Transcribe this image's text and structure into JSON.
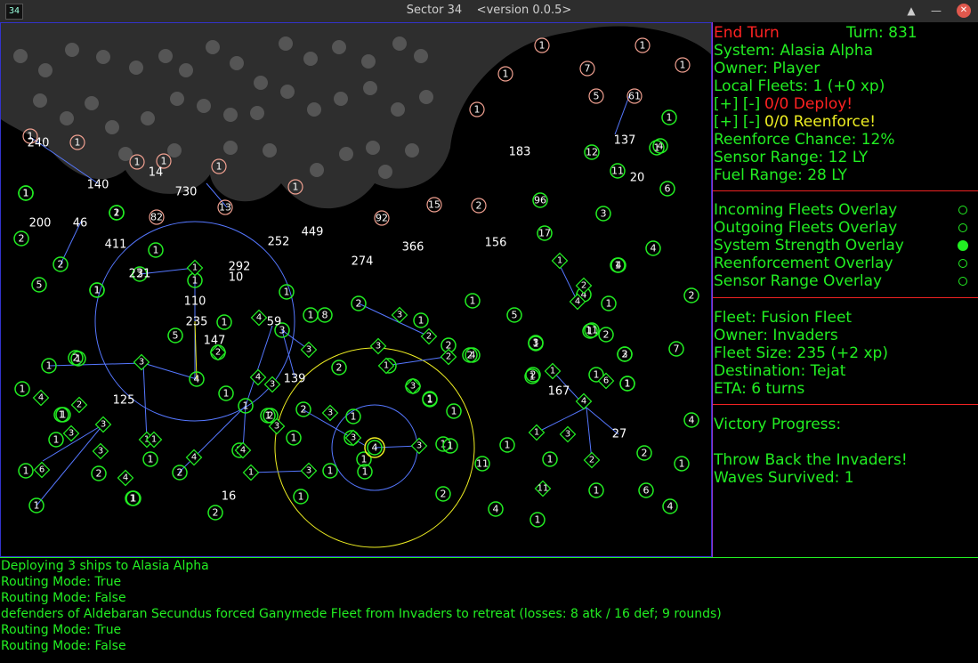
{
  "window": {
    "app_icon_text": "34",
    "title": "Sector 34    <version 0.0.5>",
    "buttons": [
      "up-icon",
      "minimize-icon",
      "close-icon"
    ]
  },
  "colors": {
    "background": "#000000",
    "friendly": "#22ee22",
    "enemy": "#f0a090",
    "neutral": "#ffffff",
    "highlight": "#ff2222",
    "warning": "#eeee22",
    "range_ring": "#5577ff",
    "selection_ring": "#eeee22",
    "nebula": "#2e2e2e",
    "nebula_dot": "#555555"
  },
  "side": {
    "end_turn": "End Turn",
    "turn": "Turn: 831",
    "system": "System: Alasia Alpha",
    "owner": "Owner: Player",
    "local_fleets": "Local Fleets: 1 (+0 xp)",
    "deploy_controls": "[+]  [-]",
    "deploy_text": "0/0 Deploy!",
    "reenforce_controls": "[+]  [-]",
    "reenforce_text": "0/0 Reenforce!",
    "reenforce_chance": "Reenforce Chance: 12%",
    "sensor_range": "Sensor Range: 12 LY",
    "fuel_range": "Fuel Range: 28 LY",
    "overlays": [
      {
        "label": "Incoming Fleets Overlay",
        "on": false
      },
      {
        "label": "Outgoing Fleets Overlay",
        "on": false
      },
      {
        "label": "System Strength Overlay",
        "on": true
      },
      {
        "label": "Reenforcement Overlay",
        "on": false
      },
      {
        "label": "Sensor Range Overlay",
        "on": false
      }
    ],
    "fleet_name": "Fleet: Fusion Fleet",
    "fleet_owner": "Owner: Invaders",
    "fleet_size": "Fleet Size: 235 (+2 xp)",
    "fleet_destination": "Destination: Tejat",
    "fleet_eta": "ETA: 6 turns",
    "victory_title": "Victory Progress:",
    "victory_goal": "Throw Back the Invaders!",
    "waves": "Waves Survived: 1"
  },
  "log": [
    "Deploying 3 ships to Alasia Alpha",
    "Routing Mode: True",
    "Routing Mode: False",
    "defenders of Aldebaran Secundus forced Ganymede Fleet from Invaders to retreat (losses: 8 atk / 16 def; 9 rounds)",
    "Routing Mode: True",
    "Routing Mode: False"
  ],
  "map": {
    "enemy_systems": [
      "1",
      "1",
      "7",
      "1",
      "1",
      "5",
      "61",
      "1",
      "1",
      "1",
      "1",
      "1",
      "1",
      "1",
      "13",
      "82",
      "15",
      "2",
      "92"
    ],
    "player_systems": [
      "1",
      "1",
      "2",
      "4",
      "2",
      "12",
      "11",
      "96",
      "6",
      "1",
      "3",
      "17",
      "2",
      "4",
      "1",
      "5",
      "1",
      "2",
      "1",
      "1",
      "5",
      "1",
      "1",
      "5",
      "2",
      "8",
      "2",
      "1",
      "2",
      "1",
      "7",
      "1",
      "2",
      "2",
      "2",
      "1",
      "3",
      "1",
      "1",
      "4",
      "1",
      "1",
      "1",
      "1",
      "1",
      "1",
      "2",
      "2",
      "4",
      "2",
      "11",
      "1",
      "1",
      "1",
      "1",
      "1",
      "1",
      "2",
      "1",
      "1",
      "2",
      "1",
      "1",
      "1",
      "1",
      "1",
      "2",
      "6",
      "1",
      "2",
      "4",
      "1",
      "4",
      "2",
      "1",
      "3",
      "1",
      "1",
      "1",
      "1",
      "1",
      "1",
      "4",
      "3",
      "11",
      "1",
      "2",
      "1",
      "1",
      "3",
      "4",
      "4",
      "1",
      "1",
      "1",
      "1",
      "2",
      "2",
      "4",
      "2",
      "1",
      "1",
      "1",
      "1"
    ],
    "player_fleets": [
      "6",
      "3",
      "4",
      "2",
      "3",
      "4",
      "3",
      "1",
      "4",
      "4",
      "3",
      "3",
      "3",
      "3",
      "1",
      "4",
      "3",
      "1",
      "4",
      "2",
      "1",
      "2",
      "2",
      "3",
      "3",
      "3",
      "3",
      "3",
      "11",
      "6",
      "4",
      "1",
      "1",
      "2",
      "3",
      "4",
      "2",
      "1",
      "1",
      "3"
    ],
    "strength_labels": [
      "240",
      "140",
      "14",
      "730",
      "200",
      "46",
      "411",
      "231",
      "292",
      "10",
      "449",
      "252",
      "274",
      "366",
      "156",
      "183",
      "137",
      "20",
      "110",
      "235",
      "147",
      "59",
      "125",
      "139",
      "167",
      "27",
      "16"
    ]
  }
}
